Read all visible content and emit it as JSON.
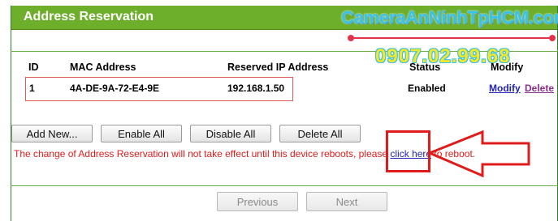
{
  "header": {
    "title": "Address Reservation"
  },
  "table": {
    "columns": {
      "id": "ID",
      "mac": "MAC Address",
      "ip": "Reserved IP Address",
      "status": "Status",
      "modify": "Modify"
    },
    "rows": [
      {
        "id": "1",
        "mac": "4A-DE-9A-72-E4-9E",
        "ip": "192.168.1.50",
        "status": "Enabled",
        "modify_label": "Modify",
        "delete_label": "Delete"
      }
    ]
  },
  "actions": {
    "add_new": "Add New...",
    "enable_all": "Enable All",
    "disable_all": "Disable All",
    "delete_all": "Delete All"
  },
  "notice": {
    "text_before": "The change of Address Reservation will not take effect until this device reboots, please ",
    "link_text": "click here",
    "text_after": " to reboot."
  },
  "pagination": {
    "previous": "Previous",
    "next": "Next"
  },
  "watermark": {
    "site": "CameraAnNinhTpHCM.com",
    "phone": "0907.02.99.68"
  },
  "colors": {
    "header_bg": "#6dae2b",
    "notice_text": "#e01b1b",
    "link": "#2323b5",
    "annotation_red": "#e01b1b"
  }
}
